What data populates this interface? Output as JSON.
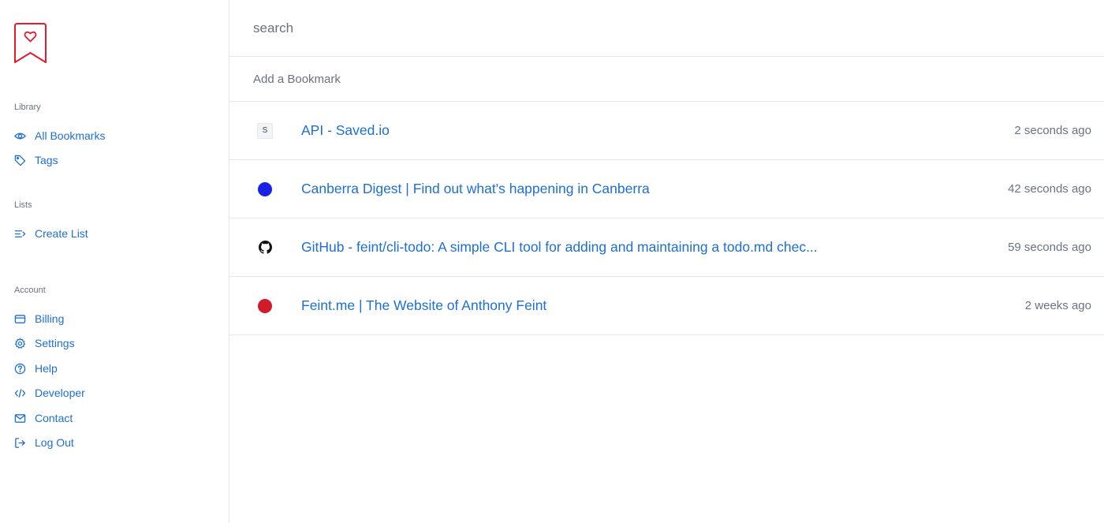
{
  "sidebar": {
    "library_title": "Library",
    "lists_title": "Lists",
    "account_title": "Account",
    "library_items": [
      {
        "label": "All Bookmarks",
        "icon": "eye-icon"
      },
      {
        "label": "Tags",
        "icon": "tag-icon"
      }
    ],
    "lists_items": [
      {
        "label": "Create List",
        "icon": "list-add-icon"
      }
    ],
    "account_items": [
      {
        "label": "Billing",
        "icon": "credit-card-icon"
      },
      {
        "label": "Settings",
        "icon": "gear-icon"
      },
      {
        "label": "Help",
        "icon": "help-circle-icon"
      },
      {
        "label": "Developer",
        "icon": "code-icon"
      },
      {
        "label": "Contact",
        "icon": "mail-icon"
      },
      {
        "label": "Log Out",
        "icon": "logout-icon"
      }
    ]
  },
  "search": {
    "placeholder": "search"
  },
  "add_bookmark": {
    "placeholder": "Add a Bookmark"
  },
  "bookmarks": [
    {
      "title": "API - Saved.io",
      "time": "2 seconds ago",
      "favicon": "S"
    },
    {
      "title": "Canberra Digest | Find out what's happening in Canberra",
      "time": "42 seconds ago",
      "favicon_color": "#1a22e8"
    },
    {
      "title": "GitHub - feint/cli-todo: A simple CLI tool for adding and maintaining a todo.md chec...",
      "time": "59 seconds ago",
      "favicon": "github-icon"
    },
    {
      "title": "Feint.me | The Website of Anthony Feint",
      "time": "2 weeks ago",
      "favicon_color": "#d11a2a"
    }
  ],
  "colors": {
    "accent": "#1d6fd6",
    "brand": "#e11d2e",
    "muted": "#6b7280",
    "border": "#e5e7eb"
  }
}
